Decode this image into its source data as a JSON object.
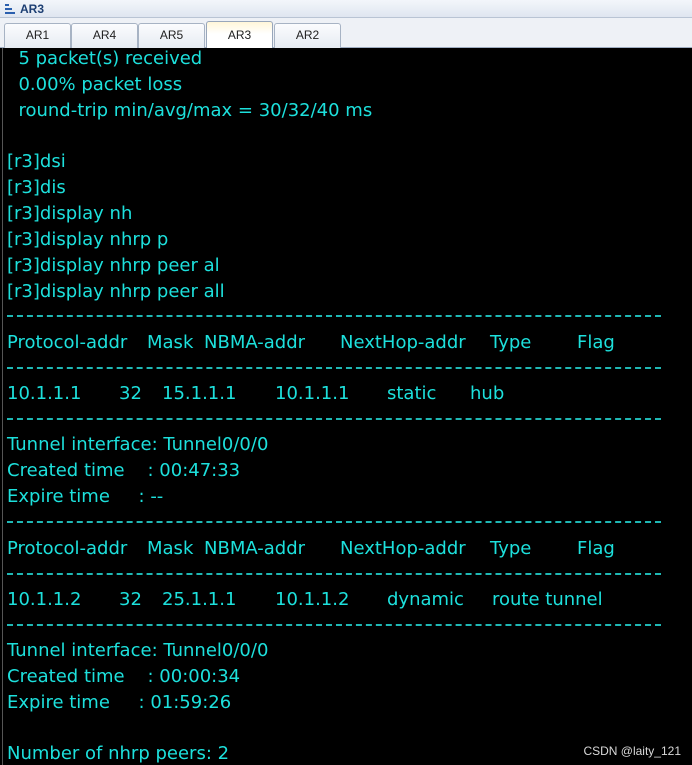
{
  "window": {
    "title": "AR3"
  },
  "tabs": [
    {
      "label": "AR1",
      "active": false
    },
    {
      "label": "AR4",
      "active": false
    },
    {
      "label": "AR5",
      "active": false
    },
    {
      "label": "AR3",
      "active": true
    },
    {
      "label": "AR2",
      "active": false
    }
  ],
  "terminal": {
    "ping_stats": [
      "  5 packet(s) received",
      "  0.00% packet loss",
      "  round-trip min/avg/max = 30/32/40 ms"
    ],
    "commands": [
      "[r3]dsi",
      "[r3]dis",
      "[r3]display nh",
      "[r3]display nhrp p",
      "[r3]display nhrp peer al",
      "[r3]display nhrp peer all"
    ],
    "header": {
      "protocol_addr": "Protocol-addr",
      "mask": "Mask",
      "nbma_addr": "NBMA-addr",
      "nexthop_addr": "NextHop-addr",
      "type": "Type",
      "flag": "Flag"
    },
    "peers": [
      {
        "protocol_addr": "10.1.1.1",
        "mask": "32",
        "nbma_addr": "15.1.1.1",
        "nexthop_addr": "10.1.1.1",
        "type": "static",
        "flag": "hub",
        "tunnel_interface": "Tunnel interface: Tunnel0/0/0",
        "created_time": "Created time    : 00:47:33",
        "expire_time": "Expire time     : --"
      },
      {
        "protocol_addr": "10.1.1.2",
        "mask": "32",
        "nbma_addr": "25.1.1.1",
        "nexthop_addr": "10.1.1.2",
        "type": "dynamic",
        "flag": "route tunnel",
        "tunnel_interface": "Tunnel interface: Tunnel0/0/0",
        "created_time": "Created time    : 00:00:34",
        "expire_time": "Expire time     : 01:59:26"
      }
    ],
    "summary": "Number of nhrp peers: 2"
  },
  "watermark": "CSDN @laity_121",
  "colors": {
    "terminal_bg": "#000000",
    "terminal_text": "#1de0dc"
  }
}
